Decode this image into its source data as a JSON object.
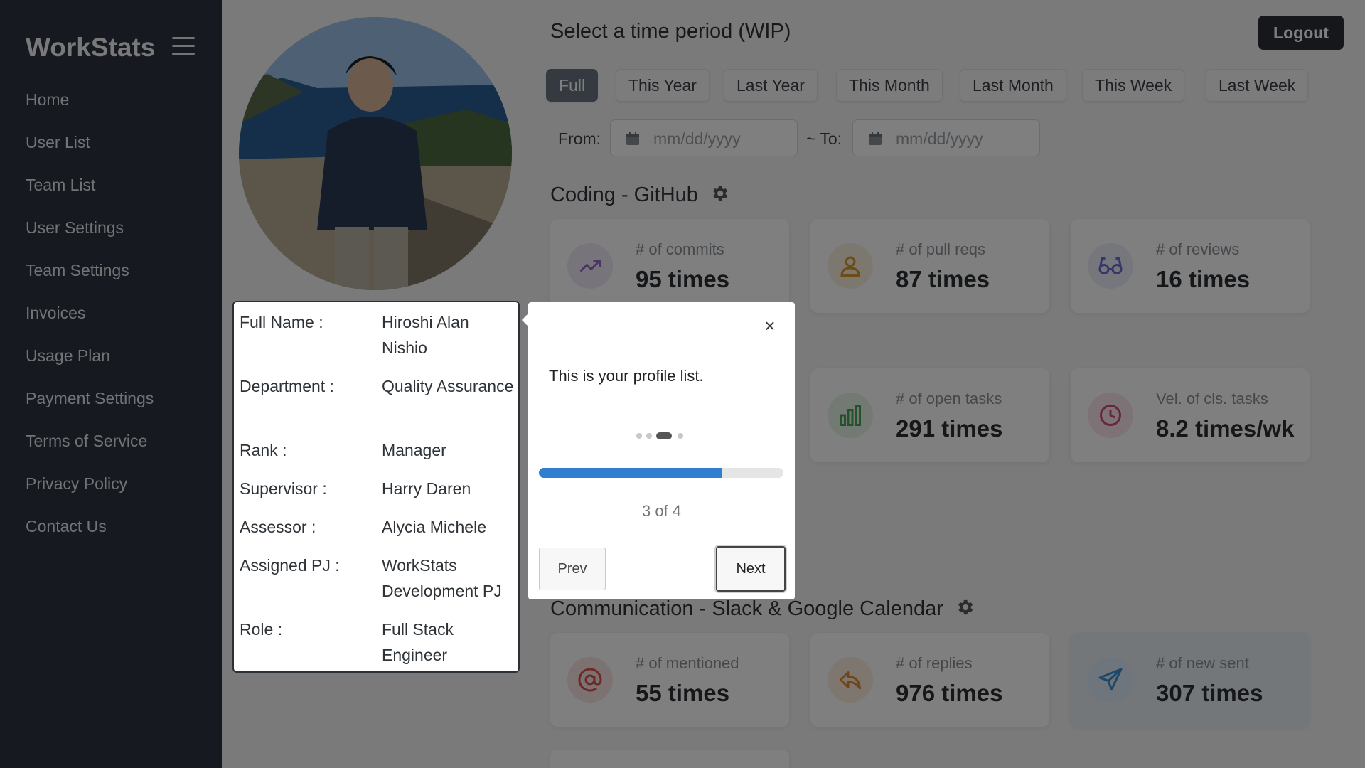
{
  "app": {
    "brand": "WorkStats"
  },
  "sidebar": {
    "items": [
      {
        "label": "Home"
      },
      {
        "label": "User List"
      },
      {
        "label": "Team List"
      },
      {
        "label": "User Settings"
      },
      {
        "label": "Team Settings"
      },
      {
        "label": "Invoices"
      },
      {
        "label": "Usage Plan"
      },
      {
        "label": "Payment Settings"
      },
      {
        "label": "Terms of Service"
      },
      {
        "label": "Privacy Policy"
      },
      {
        "label": "Contact Us"
      }
    ]
  },
  "header": {
    "title": "Select a time period (WIP)",
    "logout_label": "Logout"
  },
  "period": {
    "buttons": [
      "Full",
      "This Year",
      "Last Year",
      "This Month",
      "Last Month",
      "This Week",
      "Last Week"
    ],
    "active": "Full",
    "from_label": "From:",
    "to_label": "~ To:",
    "from_placeholder": "mm/dd/yyyy",
    "to_placeholder": "mm/dd/yyyy"
  },
  "coding": {
    "title": "Coding - GitHub",
    "cards": [
      {
        "label": "# of commits",
        "value": "95 times",
        "icon": "trending-up-icon",
        "color": "#9b6bc4"
      },
      {
        "label": "# of pull reqs",
        "value": "87 times",
        "icon": "user-icon",
        "color": "#d99a2b"
      },
      {
        "label": "# of reviews",
        "value": "16 times",
        "icon": "glasses-icon",
        "color": "#6c6fd0"
      }
    ]
  },
  "tasks": {
    "cards": [
      {
        "label": "# of open tasks",
        "value": "291 times",
        "icon": "bar-chart-icon",
        "color": "#4aa35a"
      },
      {
        "label": "Vel. of cls. tasks",
        "value": "8.2 times/wk",
        "icon": "clock-icon",
        "color": "#d24a7a"
      }
    ]
  },
  "communication": {
    "title": "Communication - Slack & Google Calendar",
    "cards": [
      {
        "label": "# of mentioned",
        "value": "55 times",
        "icon": "at-icon",
        "color": "#d9534f"
      },
      {
        "label": "# of replies",
        "value": "976 times",
        "icon": "reply-icon",
        "color": "#e08a2e"
      },
      {
        "label": "# of new sent",
        "value": "307 times",
        "icon": "send-icon",
        "color": "#3d8fd1"
      }
    ]
  },
  "profile": {
    "rows": [
      {
        "key": "Full Name :",
        "value": "Hiroshi Alan Nishio"
      },
      {
        "key": "Department :",
        "value": "Quality Assurance"
      },
      {
        "key": "Rank :",
        "value": "Manager"
      },
      {
        "key": "Supervisor :",
        "value": "Harry Daren"
      },
      {
        "key": "Assessor :",
        "value": "Alycia Michele"
      },
      {
        "key": "Assigned PJ :",
        "value": "WorkStats Development PJ"
      },
      {
        "key": "Role :",
        "value": "Full Stack Engineer"
      }
    ]
  },
  "tour": {
    "close_symbol": "×",
    "message": "This is your profile list.",
    "step": 3,
    "total": 4,
    "progress": 0.75,
    "counter": "3 of 4",
    "prev_label": "Prev",
    "next_label": "Next"
  }
}
